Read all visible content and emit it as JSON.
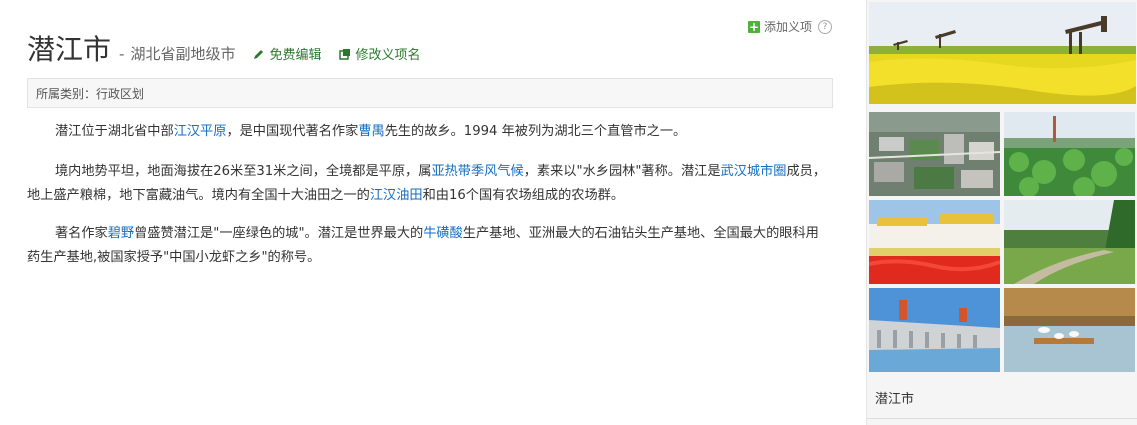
{
  "header": {
    "add_item_label": "添加义项",
    "title": "潜江市",
    "subtitle_dash": "-",
    "subtitle": "湖北省副地级市",
    "edit_label": "免费编辑",
    "modify_label": "修改义项名"
  },
  "category": {
    "text": "所属类别：行政区划"
  },
  "paragraphs": {
    "p1": {
      "t1": "潜江位于湖北省中部",
      "l1": "江汉平原",
      "t2": "，是中国现代著名作家",
      "l2": "曹禺",
      "t3": "先生的故乡。1994 年被列为湖北三个直管市之一。"
    },
    "p2": {
      "t1": "境内地势平坦，地面海拔在26米至31米之间，全境都是平原，属",
      "l1": "亚热带季风气候",
      "t2": "，素来以\"水乡园林\"著称。潜江是",
      "l2": "武汉城市圈",
      "t3": "成员，地上盛产粮棉，地下富藏油气。境内有全国十大油田之一的",
      "l3": "江汉油田",
      "t4": "和由16个国有农场组成的农场群。"
    },
    "p3": {
      "t1": "著名作家",
      "l1": "碧野",
      "t2": "曾盛赞潜江是\"一座绿色的城\"。潜江是世界最大的",
      "l2": "牛磺酸",
      "t3": "生产基地、亚洲最大的石油钻头生产基地、全国最大的眼科用药生产基地,被国家授予\"中国小龙虾之乡\"的称号。"
    }
  },
  "sidebar": {
    "caption": "潜江市"
  },
  "colors": {
    "link": "#136ec2",
    "action_green": "#2b7a2b",
    "plus_green": "#4fb03b"
  }
}
